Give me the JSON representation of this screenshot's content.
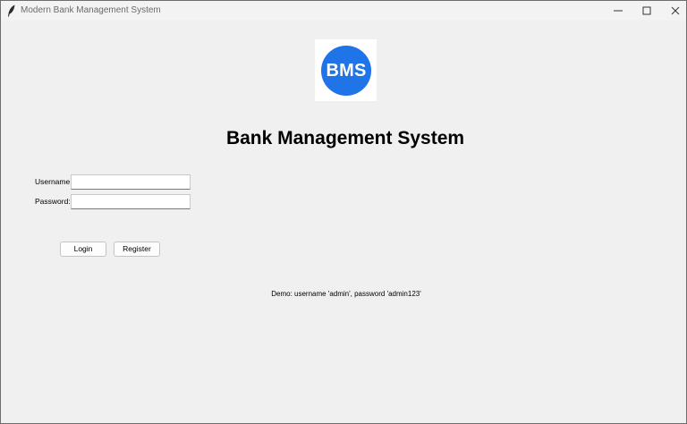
{
  "window": {
    "title": "Modern Bank Management System",
    "icons": {
      "app": "feather-icon",
      "minimize": "minimize-icon",
      "maximize": "maximize-icon",
      "close": "close-icon"
    }
  },
  "logo": {
    "text": "BMS",
    "color": "#1f74e8"
  },
  "header": {
    "title": "Bank Management System"
  },
  "form": {
    "username_label": "Username:",
    "username_value": "",
    "password_label": "Password:",
    "password_value": ""
  },
  "buttons": {
    "login": "Login",
    "register": "Register"
  },
  "hint": {
    "demo": "Demo: username 'admin', password 'admin123'"
  }
}
